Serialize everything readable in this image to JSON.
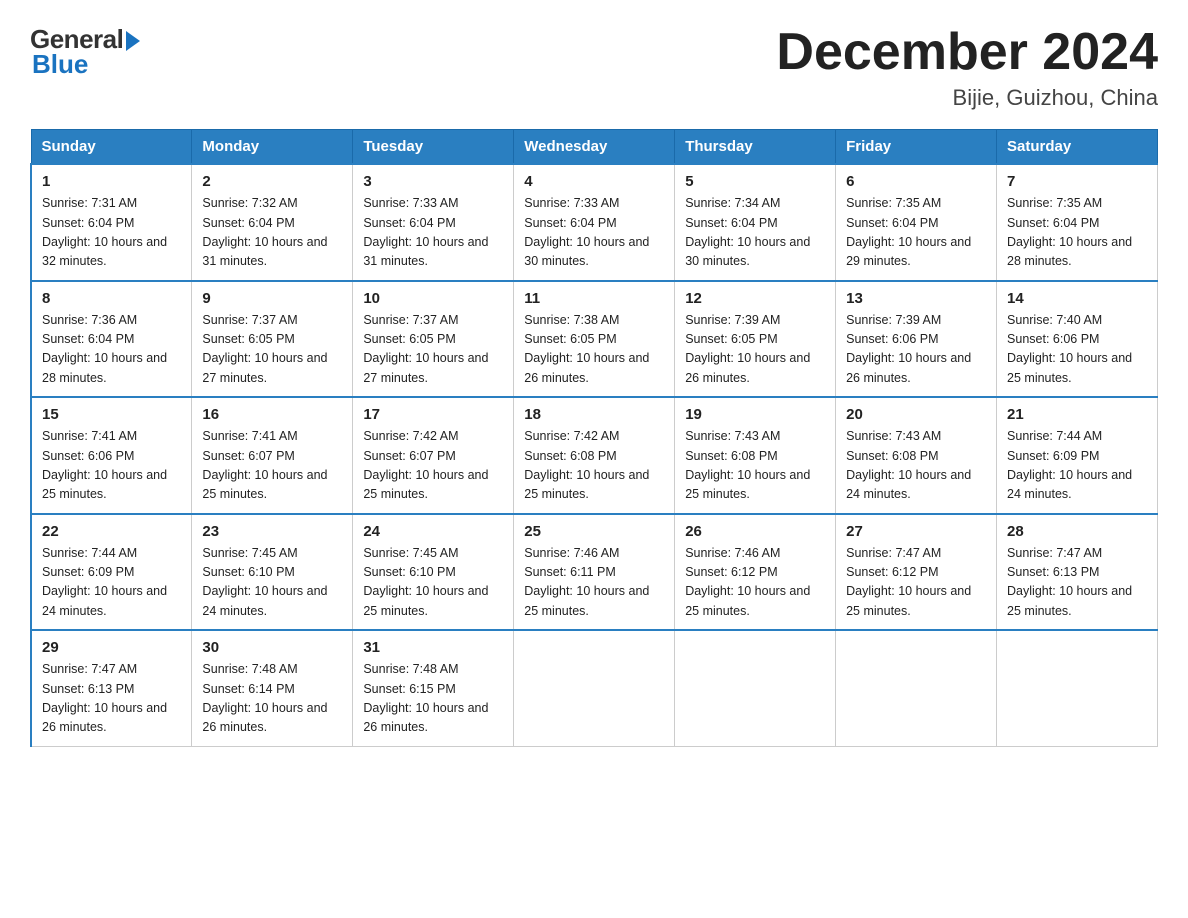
{
  "header": {
    "logo_general": "General",
    "logo_blue": "Blue",
    "title": "December 2024",
    "location": "Bijie, Guizhou, China"
  },
  "weekdays": [
    "Sunday",
    "Monday",
    "Tuesday",
    "Wednesday",
    "Thursday",
    "Friday",
    "Saturday"
  ],
  "weeks": [
    [
      {
        "day": "1",
        "sunrise": "7:31 AM",
        "sunset": "6:04 PM",
        "daylight": "10 hours and 32 minutes."
      },
      {
        "day": "2",
        "sunrise": "7:32 AM",
        "sunset": "6:04 PM",
        "daylight": "10 hours and 31 minutes."
      },
      {
        "day": "3",
        "sunrise": "7:33 AM",
        "sunset": "6:04 PM",
        "daylight": "10 hours and 31 minutes."
      },
      {
        "day": "4",
        "sunrise": "7:33 AM",
        "sunset": "6:04 PM",
        "daylight": "10 hours and 30 minutes."
      },
      {
        "day": "5",
        "sunrise": "7:34 AM",
        "sunset": "6:04 PM",
        "daylight": "10 hours and 30 minutes."
      },
      {
        "day": "6",
        "sunrise": "7:35 AM",
        "sunset": "6:04 PM",
        "daylight": "10 hours and 29 minutes."
      },
      {
        "day": "7",
        "sunrise": "7:35 AM",
        "sunset": "6:04 PM",
        "daylight": "10 hours and 28 minutes."
      }
    ],
    [
      {
        "day": "8",
        "sunrise": "7:36 AM",
        "sunset": "6:04 PM",
        "daylight": "10 hours and 28 minutes."
      },
      {
        "day": "9",
        "sunrise": "7:37 AM",
        "sunset": "6:05 PM",
        "daylight": "10 hours and 27 minutes."
      },
      {
        "day": "10",
        "sunrise": "7:37 AM",
        "sunset": "6:05 PM",
        "daylight": "10 hours and 27 minutes."
      },
      {
        "day": "11",
        "sunrise": "7:38 AM",
        "sunset": "6:05 PM",
        "daylight": "10 hours and 26 minutes."
      },
      {
        "day": "12",
        "sunrise": "7:39 AM",
        "sunset": "6:05 PM",
        "daylight": "10 hours and 26 minutes."
      },
      {
        "day": "13",
        "sunrise": "7:39 AM",
        "sunset": "6:06 PM",
        "daylight": "10 hours and 26 minutes."
      },
      {
        "day": "14",
        "sunrise": "7:40 AM",
        "sunset": "6:06 PM",
        "daylight": "10 hours and 25 minutes."
      }
    ],
    [
      {
        "day": "15",
        "sunrise": "7:41 AM",
        "sunset": "6:06 PM",
        "daylight": "10 hours and 25 minutes."
      },
      {
        "day": "16",
        "sunrise": "7:41 AM",
        "sunset": "6:07 PM",
        "daylight": "10 hours and 25 minutes."
      },
      {
        "day": "17",
        "sunrise": "7:42 AM",
        "sunset": "6:07 PM",
        "daylight": "10 hours and 25 minutes."
      },
      {
        "day": "18",
        "sunrise": "7:42 AM",
        "sunset": "6:08 PM",
        "daylight": "10 hours and 25 minutes."
      },
      {
        "day": "19",
        "sunrise": "7:43 AM",
        "sunset": "6:08 PM",
        "daylight": "10 hours and 25 minutes."
      },
      {
        "day": "20",
        "sunrise": "7:43 AM",
        "sunset": "6:08 PM",
        "daylight": "10 hours and 24 minutes."
      },
      {
        "day": "21",
        "sunrise": "7:44 AM",
        "sunset": "6:09 PM",
        "daylight": "10 hours and 24 minutes."
      }
    ],
    [
      {
        "day": "22",
        "sunrise": "7:44 AM",
        "sunset": "6:09 PM",
        "daylight": "10 hours and 24 minutes."
      },
      {
        "day": "23",
        "sunrise": "7:45 AM",
        "sunset": "6:10 PM",
        "daylight": "10 hours and 24 minutes."
      },
      {
        "day": "24",
        "sunrise": "7:45 AM",
        "sunset": "6:10 PM",
        "daylight": "10 hours and 25 minutes."
      },
      {
        "day": "25",
        "sunrise": "7:46 AM",
        "sunset": "6:11 PM",
        "daylight": "10 hours and 25 minutes."
      },
      {
        "day": "26",
        "sunrise": "7:46 AM",
        "sunset": "6:12 PM",
        "daylight": "10 hours and 25 minutes."
      },
      {
        "day": "27",
        "sunrise": "7:47 AM",
        "sunset": "6:12 PM",
        "daylight": "10 hours and 25 minutes."
      },
      {
        "day": "28",
        "sunrise": "7:47 AM",
        "sunset": "6:13 PM",
        "daylight": "10 hours and 25 minutes."
      }
    ],
    [
      {
        "day": "29",
        "sunrise": "7:47 AM",
        "sunset": "6:13 PM",
        "daylight": "10 hours and 26 minutes."
      },
      {
        "day": "30",
        "sunrise": "7:48 AM",
        "sunset": "6:14 PM",
        "daylight": "10 hours and 26 minutes."
      },
      {
        "day": "31",
        "sunrise": "7:48 AM",
        "sunset": "6:15 PM",
        "daylight": "10 hours and 26 minutes."
      },
      null,
      null,
      null,
      null
    ]
  ]
}
